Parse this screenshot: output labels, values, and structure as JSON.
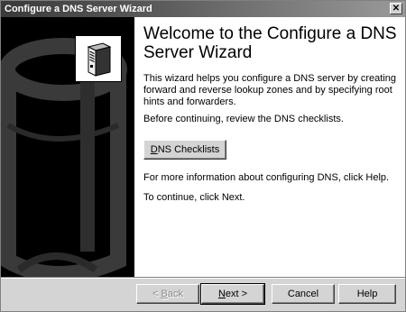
{
  "window": {
    "title": "Configure a DNS Server Wizard",
    "close_glyph": "✕"
  },
  "side_panel": {
    "icon": "server-icon",
    "background_art": "cylinder-watermark"
  },
  "content": {
    "heading": "Welcome to the Configure a DNS Server Wizard",
    "intro": "This wizard helps you configure a DNS server by creating forward and reverse lookup zones and by specifying root hints and forwarders.",
    "before_continuing": "Before continuing, review the DNS checklists.",
    "checklists_button": {
      "accel": "D",
      "rest": "NS Checklists"
    },
    "more_info": "For more information about configuring DNS, click Help.",
    "to_continue": "To continue, click Next."
  },
  "buttons": {
    "back": {
      "prefix": "< ",
      "accel": "B",
      "rest": "ack",
      "enabled": false
    },
    "next": {
      "accel": "N",
      "rest": "ext >",
      "default": true
    },
    "cancel": "Cancel",
    "help": "Help"
  },
  "colors": {
    "titlebar_start": "#3a3a3a",
    "titlebar_end": "#9a9a9a",
    "side_panel": "#000000",
    "dialog_face": "#d4d4d4"
  }
}
